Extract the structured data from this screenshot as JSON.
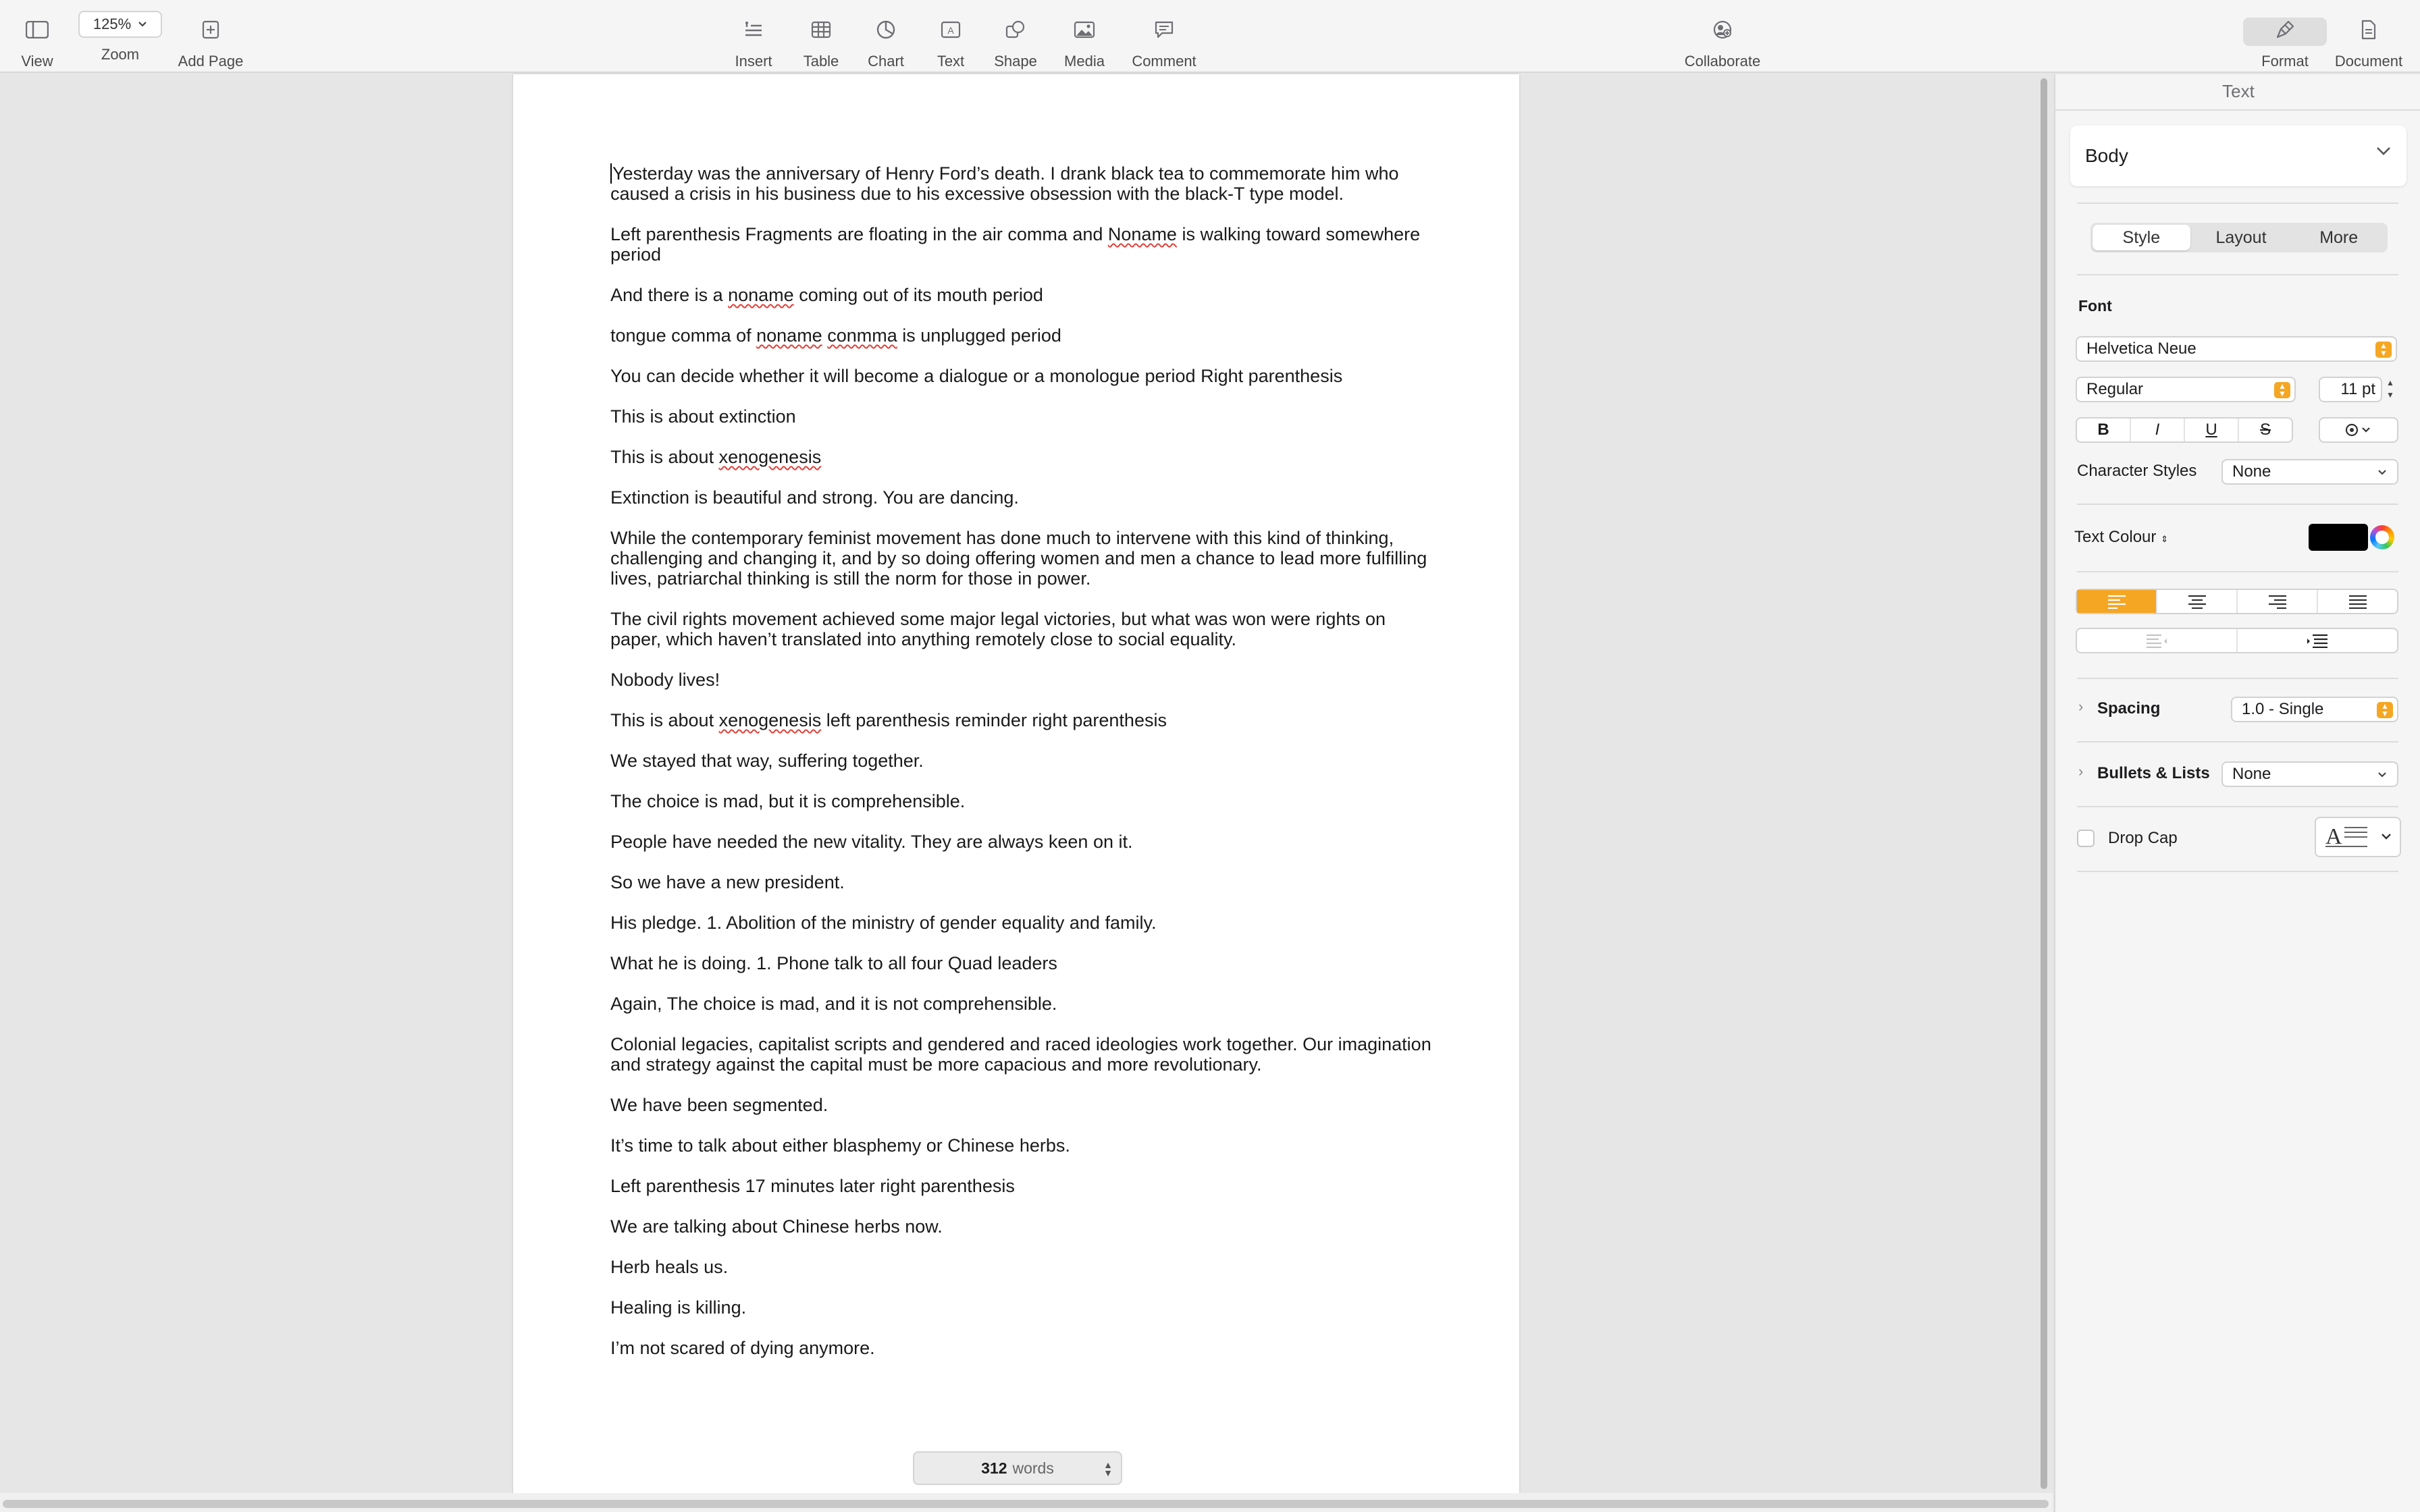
{
  "toolbar": {
    "view_label": "View",
    "zoom_value": "125%",
    "zoom_label": "Zoom",
    "add_page_label": "Add Page",
    "insert_label": "Insert",
    "table_label": "Table",
    "chart_label": "Chart",
    "text_label": "Text",
    "shape_label": "Shape",
    "media_label": "Media",
    "comment_label": "Comment",
    "collaborate_label": "Collaborate",
    "format_label": "Format",
    "document_label": "Document"
  },
  "document": {
    "paragraphs": [
      [
        "Yesterday was the anniversary of Henry Ford’s death. I drank black tea to commemorate him who caused a crisis in his business due to his excessive obsession with the black-T type model."
      ],
      [
        "Left parenthesis Fragments are floating in the air comma and ",
        "Noname",
        " is walking toward somewhere period"
      ],
      [
        "And there is a ",
        "noname",
        " coming out of its mouth period"
      ],
      [
        "tongue comma of ",
        "noname",
        " ",
        "conmma",
        " is unplugged period"
      ],
      [
        "You can decide whether it will become a dialogue or a monologue period Right parenthesis"
      ],
      [
        "This is about extinction"
      ],
      [
        "This is about ",
        "xenogenesis"
      ],
      [
        "Extinction is beautiful and strong. You are dancing."
      ],
      [
        "While the contemporary feminist movement has done much to intervene with this kind of thinking, challenging and changing it, and by so doing offering women and men a chance to lead more fulfilling lives, patriarchal thinking is still the norm for those in power."
      ],
      [
        "The civil rights movement achieved some major legal victories, but what was won were rights on paper, which haven’t translated into anything remotely close to social equality."
      ],
      [
        "Nobody lives!"
      ],
      [
        "This is about ",
        "xenogenesis",
        " left parenthesis reminder right parenthesis"
      ],
      [
        "We stayed that way, suffering together."
      ],
      [
        "The choice is mad, but it is comprehensible."
      ],
      [
        "People have needed the new vitality. They are always keen on it."
      ],
      [
        "So we have a new president."
      ],
      [
        "His pledge. 1. Abolition of the ministry of gender equality and family."
      ],
      [
        "What he is doing. 1. Phone talk to all four Quad leaders"
      ],
      [
        "Again, The choice is mad, and it is not comprehensible."
      ],
      [
        "Colonial legacies, capitalist scripts and gendered and raced ideologies work together. Our imagination and strategy against the capital must be more capacious and more revolutionary."
      ],
      [
        "We have been segmented."
      ],
      [
        "It’s time to talk about either blasphemy or Chinese herbs."
      ],
      [
        "Left parenthesis 17 minutes later right parenthesis"
      ],
      [
        "We are talking about Chinese herbs now."
      ],
      [
        "Herb heals us."
      ],
      [
        "Healing is killing."
      ],
      [
        "I’m not scared of dying anymore."
      ]
    ],
    "word_count": "312",
    "word_count_unit": "words"
  },
  "inspector": {
    "title": "Text",
    "paragraph_style": "Body",
    "tabs": [
      "Style",
      "Layout",
      "More"
    ],
    "active_tab": "Style",
    "font_label": "Font",
    "font_family": "Helvetica Neue",
    "font_weight": "Regular",
    "font_size": "11 pt",
    "format_buttons": [
      "B",
      "I",
      "U",
      "S"
    ],
    "character_styles_label": "Character Styles",
    "character_styles_value": "None",
    "text_colour_label": "Text Colour",
    "text_colour": "#000000",
    "accent_color": "#f5a623",
    "alignment_active": "left",
    "spacing_label": "Spacing",
    "spacing_value": "1.0 - Single",
    "bullets_label": "Bullets & Lists",
    "bullets_value": "None",
    "drop_cap_label": "Drop Cap",
    "drop_cap_checked": false
  },
  "spelling_underline_color": "#e0413a"
}
